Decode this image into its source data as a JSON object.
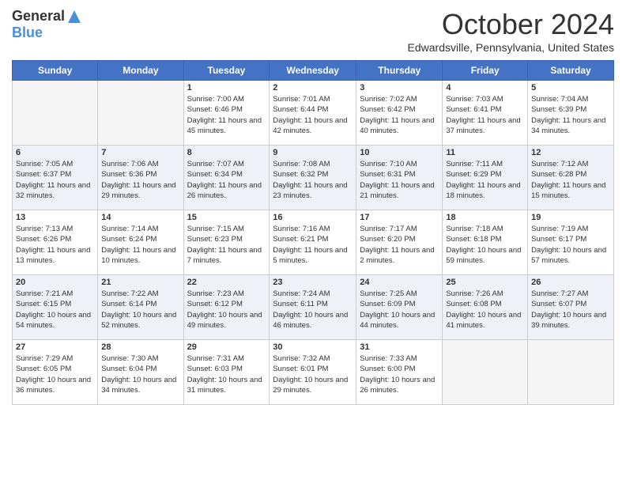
{
  "header": {
    "logo": {
      "general": "General",
      "blue": "Blue"
    },
    "title": "October 2024",
    "location": "Edwardsville, Pennsylvania, United States"
  },
  "weekdays": [
    "Sunday",
    "Monday",
    "Tuesday",
    "Wednesday",
    "Thursday",
    "Friday",
    "Saturday"
  ],
  "weeks": [
    [
      {
        "day": "",
        "sunrise": "",
        "sunset": "",
        "daylight": ""
      },
      {
        "day": "",
        "sunrise": "",
        "sunset": "",
        "daylight": ""
      },
      {
        "day": "1",
        "sunrise": "Sunrise: 7:00 AM",
        "sunset": "Sunset: 6:46 PM",
        "daylight": "Daylight: 11 hours and 45 minutes."
      },
      {
        "day": "2",
        "sunrise": "Sunrise: 7:01 AM",
        "sunset": "Sunset: 6:44 PM",
        "daylight": "Daylight: 11 hours and 42 minutes."
      },
      {
        "day": "3",
        "sunrise": "Sunrise: 7:02 AM",
        "sunset": "Sunset: 6:42 PM",
        "daylight": "Daylight: 11 hours and 40 minutes."
      },
      {
        "day": "4",
        "sunrise": "Sunrise: 7:03 AM",
        "sunset": "Sunset: 6:41 PM",
        "daylight": "Daylight: 11 hours and 37 minutes."
      },
      {
        "day": "5",
        "sunrise": "Sunrise: 7:04 AM",
        "sunset": "Sunset: 6:39 PM",
        "daylight": "Daylight: 11 hours and 34 minutes."
      }
    ],
    [
      {
        "day": "6",
        "sunrise": "Sunrise: 7:05 AM",
        "sunset": "Sunset: 6:37 PM",
        "daylight": "Daylight: 11 hours and 32 minutes."
      },
      {
        "day": "7",
        "sunrise": "Sunrise: 7:06 AM",
        "sunset": "Sunset: 6:36 PM",
        "daylight": "Daylight: 11 hours and 29 minutes."
      },
      {
        "day": "8",
        "sunrise": "Sunrise: 7:07 AM",
        "sunset": "Sunset: 6:34 PM",
        "daylight": "Daylight: 11 hours and 26 minutes."
      },
      {
        "day": "9",
        "sunrise": "Sunrise: 7:08 AM",
        "sunset": "Sunset: 6:32 PM",
        "daylight": "Daylight: 11 hours and 23 minutes."
      },
      {
        "day": "10",
        "sunrise": "Sunrise: 7:10 AM",
        "sunset": "Sunset: 6:31 PM",
        "daylight": "Daylight: 11 hours and 21 minutes."
      },
      {
        "day": "11",
        "sunrise": "Sunrise: 7:11 AM",
        "sunset": "Sunset: 6:29 PM",
        "daylight": "Daylight: 11 hours and 18 minutes."
      },
      {
        "day": "12",
        "sunrise": "Sunrise: 7:12 AM",
        "sunset": "Sunset: 6:28 PM",
        "daylight": "Daylight: 11 hours and 15 minutes."
      }
    ],
    [
      {
        "day": "13",
        "sunrise": "Sunrise: 7:13 AM",
        "sunset": "Sunset: 6:26 PM",
        "daylight": "Daylight: 11 hours and 13 minutes."
      },
      {
        "day": "14",
        "sunrise": "Sunrise: 7:14 AM",
        "sunset": "Sunset: 6:24 PM",
        "daylight": "Daylight: 11 hours and 10 minutes."
      },
      {
        "day": "15",
        "sunrise": "Sunrise: 7:15 AM",
        "sunset": "Sunset: 6:23 PM",
        "daylight": "Daylight: 11 hours and 7 minutes."
      },
      {
        "day": "16",
        "sunrise": "Sunrise: 7:16 AM",
        "sunset": "Sunset: 6:21 PM",
        "daylight": "Daylight: 11 hours and 5 minutes."
      },
      {
        "day": "17",
        "sunrise": "Sunrise: 7:17 AM",
        "sunset": "Sunset: 6:20 PM",
        "daylight": "Daylight: 11 hours and 2 minutes."
      },
      {
        "day": "18",
        "sunrise": "Sunrise: 7:18 AM",
        "sunset": "Sunset: 6:18 PM",
        "daylight": "Daylight: 10 hours and 59 minutes."
      },
      {
        "day": "19",
        "sunrise": "Sunrise: 7:19 AM",
        "sunset": "Sunset: 6:17 PM",
        "daylight": "Daylight: 10 hours and 57 minutes."
      }
    ],
    [
      {
        "day": "20",
        "sunrise": "Sunrise: 7:21 AM",
        "sunset": "Sunset: 6:15 PM",
        "daylight": "Daylight: 10 hours and 54 minutes."
      },
      {
        "day": "21",
        "sunrise": "Sunrise: 7:22 AM",
        "sunset": "Sunset: 6:14 PM",
        "daylight": "Daylight: 10 hours and 52 minutes."
      },
      {
        "day": "22",
        "sunrise": "Sunrise: 7:23 AM",
        "sunset": "Sunset: 6:12 PM",
        "daylight": "Daylight: 10 hours and 49 minutes."
      },
      {
        "day": "23",
        "sunrise": "Sunrise: 7:24 AM",
        "sunset": "Sunset: 6:11 PM",
        "daylight": "Daylight: 10 hours and 46 minutes."
      },
      {
        "day": "24",
        "sunrise": "Sunrise: 7:25 AM",
        "sunset": "Sunset: 6:09 PM",
        "daylight": "Daylight: 10 hours and 44 minutes."
      },
      {
        "day": "25",
        "sunrise": "Sunrise: 7:26 AM",
        "sunset": "Sunset: 6:08 PM",
        "daylight": "Daylight: 10 hours and 41 minutes."
      },
      {
        "day": "26",
        "sunrise": "Sunrise: 7:27 AM",
        "sunset": "Sunset: 6:07 PM",
        "daylight": "Daylight: 10 hours and 39 minutes."
      }
    ],
    [
      {
        "day": "27",
        "sunrise": "Sunrise: 7:29 AM",
        "sunset": "Sunset: 6:05 PM",
        "daylight": "Daylight: 10 hours and 36 minutes."
      },
      {
        "day": "28",
        "sunrise": "Sunrise: 7:30 AM",
        "sunset": "Sunset: 6:04 PM",
        "daylight": "Daylight: 10 hours and 34 minutes."
      },
      {
        "day": "29",
        "sunrise": "Sunrise: 7:31 AM",
        "sunset": "Sunset: 6:03 PM",
        "daylight": "Daylight: 10 hours and 31 minutes."
      },
      {
        "day": "30",
        "sunrise": "Sunrise: 7:32 AM",
        "sunset": "Sunset: 6:01 PM",
        "daylight": "Daylight: 10 hours and 29 minutes."
      },
      {
        "day": "31",
        "sunrise": "Sunrise: 7:33 AM",
        "sunset": "Sunset: 6:00 PM",
        "daylight": "Daylight: 10 hours and 26 minutes."
      },
      {
        "day": "",
        "sunrise": "",
        "sunset": "",
        "daylight": ""
      },
      {
        "day": "",
        "sunrise": "",
        "sunset": "",
        "daylight": ""
      }
    ]
  ]
}
